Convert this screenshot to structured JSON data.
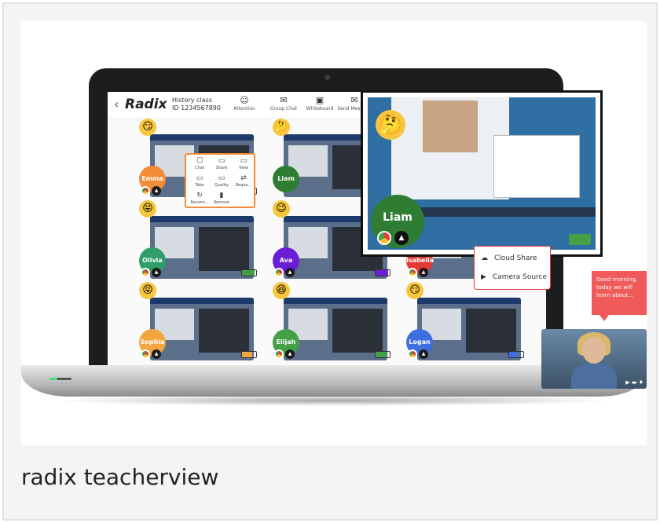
{
  "caption": "radix teacherview",
  "app": {
    "logo": "Radix",
    "class_name": "History class",
    "class_id": "ID 1234567890",
    "back_icon": "chevron-left-icon"
  },
  "toolbar": [
    {
      "label": "Attention",
      "icon": "☺"
    },
    {
      "label": "Group Chat",
      "icon": "✉"
    },
    {
      "label": "Whiteboard",
      "icon": "▣"
    },
    {
      "label": "Send Message",
      "icon": "✉"
    }
  ],
  "tile_menu": {
    "items": [
      {
        "label": "Chat",
        "icon": "☐"
      },
      {
        "label": "Share",
        "icon": "▭"
      },
      {
        "label": "View",
        "icon": "▭"
      },
      {
        "label": "Tabs",
        "icon": "▭"
      },
      {
        "label": "Quality",
        "icon": "▭"
      },
      {
        "label": "Reque...",
        "icon": "⇄"
      },
      {
        "label": "Reconn...",
        "icon": "↻"
      },
      {
        "label": "Remove",
        "icon": "▮"
      }
    ]
  },
  "students": [
    {
      "name": "Emma",
      "color": "#f28c38",
      "emoji": "😏",
      "battery": 0.8,
      "battery_color": "#f2a640"
    },
    {
      "name": "Liam",
      "color": "#2e7d32",
      "emoji": "🤔",
      "battery": 1.0,
      "battery_color": "#43a047"
    },
    {
      "name": "",
      "color": "#e53935",
      "emoji": "",
      "battery": 0.0,
      "battery_color": "#43a047"
    },
    {
      "name": "Olivia",
      "color": "#2e9d6a",
      "emoji": "😝",
      "battery": 0.9,
      "battery_color": "#43a047"
    },
    {
      "name": "Ava",
      "color": "#6a1fd6",
      "emoji": "😉",
      "battery": 0.9,
      "battery_color": "#6a1fd6"
    },
    {
      "name": "Isabella",
      "color": "#e53935",
      "emoji": "",
      "battery": 0.0,
      "battery_color": "#e53935"
    },
    {
      "name": "Sophia",
      "color": "#f2a640",
      "emoji": "😝",
      "battery": 0.7,
      "battery_color": "#f2a640"
    },
    {
      "name": "Elijah",
      "color": "#43a047",
      "emoji": "😆",
      "battery": 0.8,
      "battery_color": "#43a047"
    },
    {
      "name": "Logan",
      "color": "#3d6fe0",
      "emoji": "😏",
      "battery": 0.6,
      "battery_color": "#3d6fe0"
    }
  ],
  "popup": {
    "name": "Liam",
    "emoji": "🤔"
  },
  "dropdown": {
    "items": [
      {
        "label": "Cloud Share",
        "icon": "☁"
      },
      {
        "label": "Camera Source",
        "icon": "▶"
      }
    ]
  },
  "bubble": {
    "text": "Good morning, today we will learn about..."
  }
}
